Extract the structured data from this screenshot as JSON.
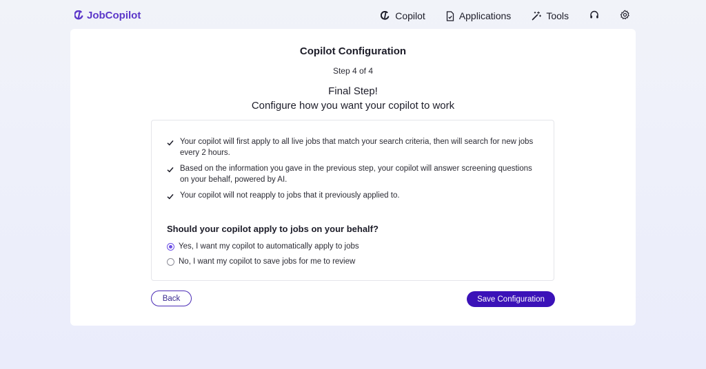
{
  "brand": {
    "name": "JobCopilot",
    "color": "#5b36c9"
  },
  "nav": {
    "items": [
      {
        "label": "Copilot",
        "icon": "copilot-icon"
      },
      {
        "label": "Applications",
        "icon": "document-icon"
      },
      {
        "label": "Tools",
        "icon": "magic-wand-icon"
      }
    ],
    "support_icon": "headset-icon",
    "settings_icon": "gear-icon"
  },
  "config": {
    "title": "Copilot Configuration",
    "step": "Step 4 of 4",
    "heading1": "Final Step!",
    "heading2": "Configure how you want your copilot to work",
    "bullets": [
      "Your copilot will first apply to all live jobs that match your search criteria, then will search for new jobs every 2 hours.",
      "Based on the information you gave in the previous step, your copilot will answer screening questions on your behalf, powered by AI.",
      "Your copilot will not reapply to jobs that it previously applied to."
    ],
    "question": "Should your copilot apply to jobs on your behalf?",
    "options": [
      {
        "label": "Yes, I want my copilot to automatically apply to jobs",
        "selected": true
      },
      {
        "label": "No, I want my copilot to save jobs for me to review",
        "selected": false
      }
    ],
    "back_label": "Back",
    "save_label": "Save Configuration"
  },
  "colors": {
    "accent": "#3b12b8",
    "radio": "#6b4ee6"
  }
}
